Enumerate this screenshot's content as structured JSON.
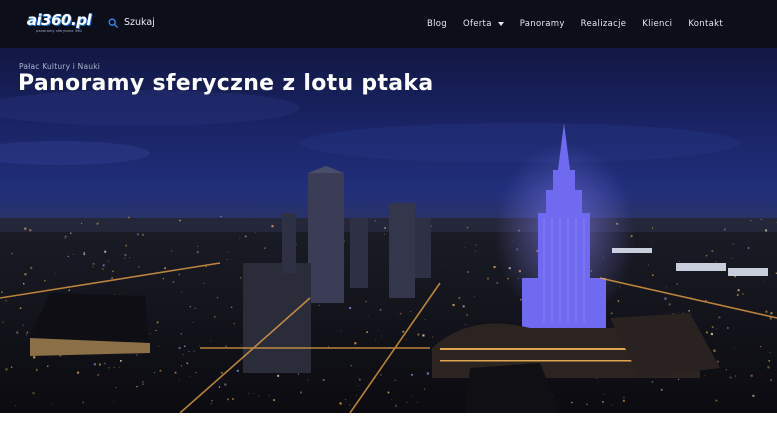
{
  "header": {
    "logo_text": "ai360.pl",
    "logo_subtext": "panoramy sferyczne 360",
    "search": {
      "placeholder": "Szukaj"
    },
    "nav": [
      {
        "label": "Blog"
      },
      {
        "label": "Oferta",
        "has_dropdown": true
      },
      {
        "label": "Panoramy"
      },
      {
        "label": "Realizacje"
      },
      {
        "label": "Klienci"
      },
      {
        "label": "Kontakt"
      }
    ]
  },
  "hero": {
    "breadcrumb": "Pałac Kultury i Nauki",
    "title": "Panoramy sferyczne z lotu ptaka"
  },
  "colors": {
    "header_bg": "#0c0f1a",
    "search_icon": "#3b8cff",
    "text_light": "#e4e8f0",
    "sky_top": "#121743",
    "palace_glow": "#7a72ff"
  },
  "icons": {
    "search": "search-icon",
    "dropdown": "chevron-down-icon"
  }
}
